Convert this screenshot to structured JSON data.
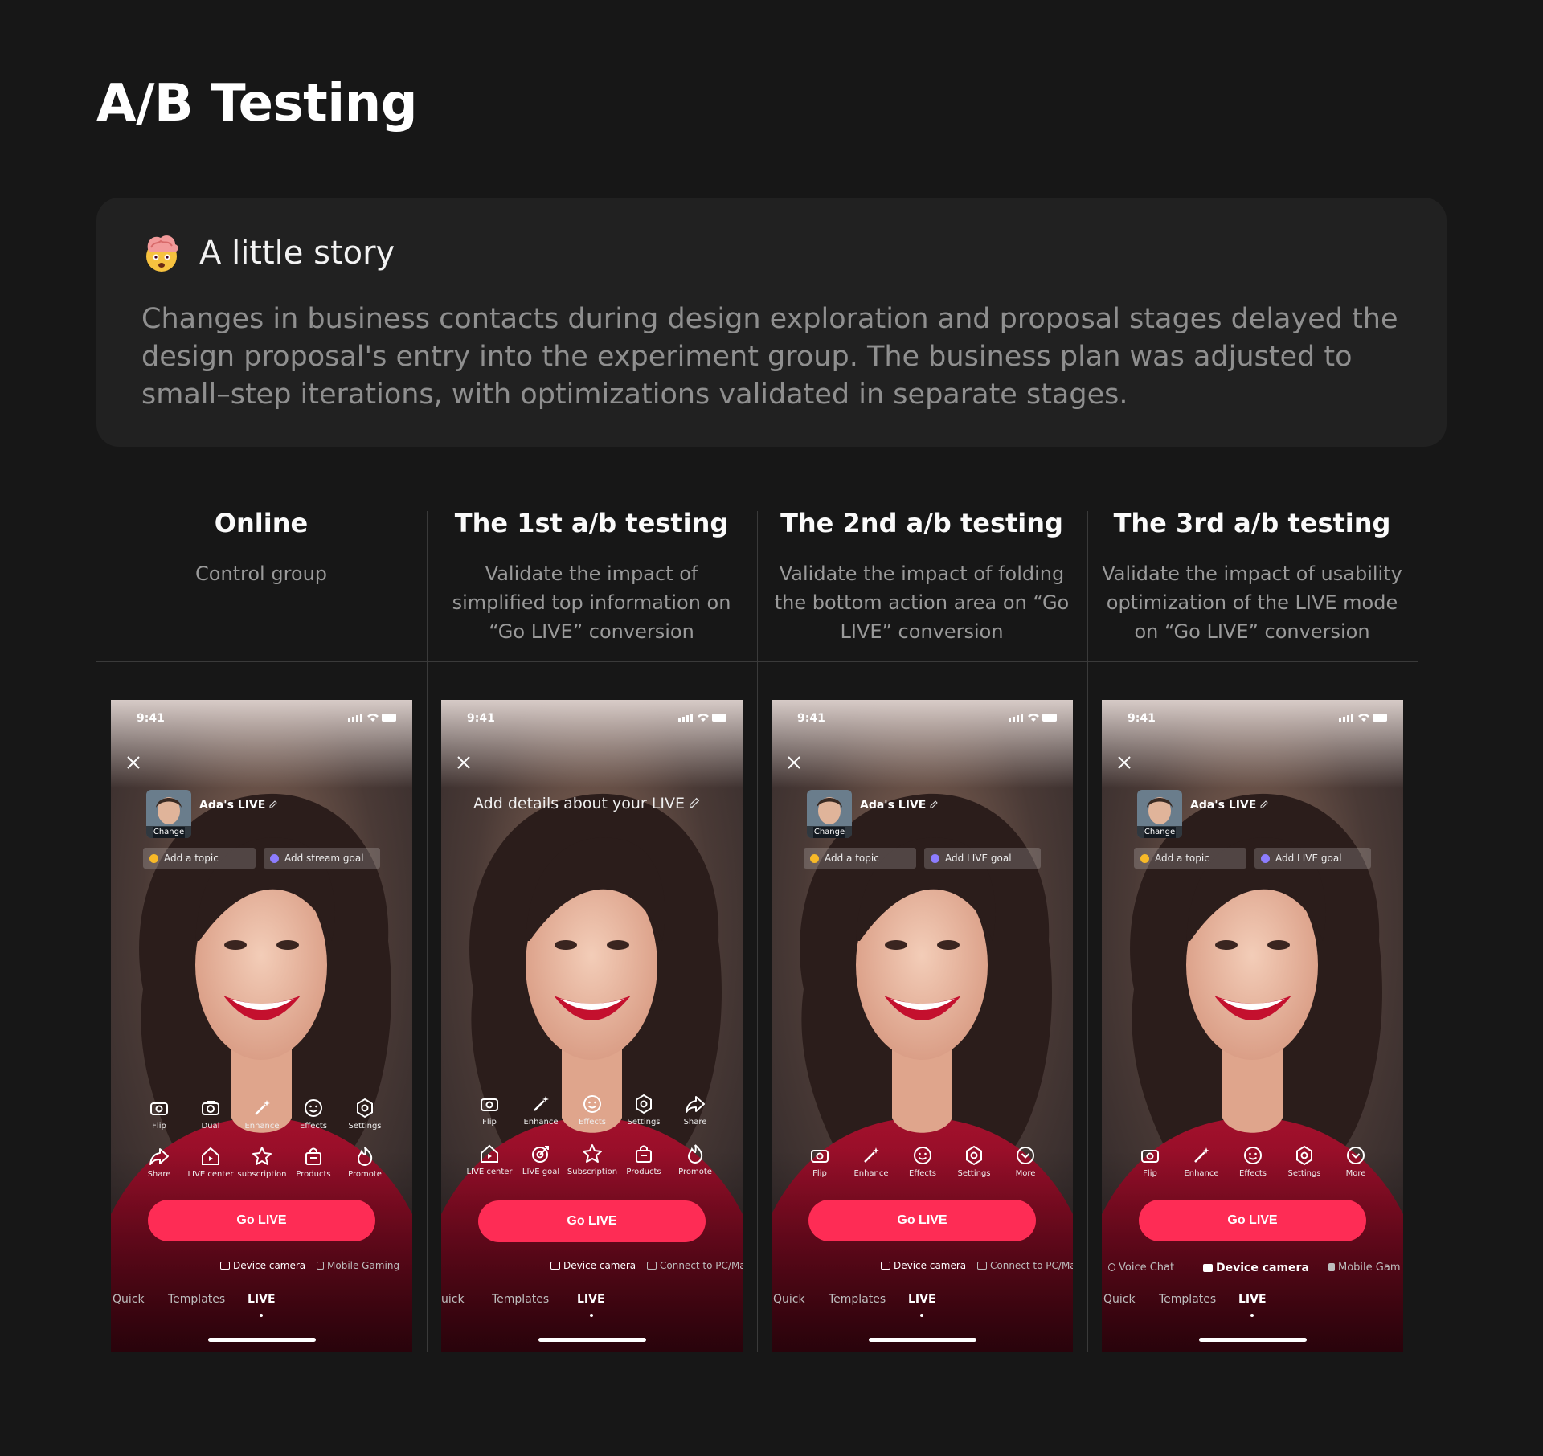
{
  "page": {
    "title": "A/B Testing"
  },
  "story": {
    "heading": "A little story",
    "body": "Changes in business contacts during design exploration and proposal stages delayed the design proposal's entry into the experiment group. The business plan was adjusted to small–step iterations, with optimizations validated in separate stages."
  },
  "columns": [
    {
      "title": "Online",
      "desc": "Control group"
    },
    {
      "title": "The 1st a/b testing",
      "desc": "Validate the impact of simplified top information on “Go LIVE” conversion"
    },
    {
      "title": "The 2nd a/b testing",
      "desc": "Validate the impact of folding the bottom action area on “Go LIVE” conversion"
    },
    {
      "title": "The 3rd a/b testing",
      "desc": "Validate the impact of usability optimization of the LIVE mode on “Go LIVE” conversion"
    }
  ],
  "phones": [
    {
      "status_time": "9:41",
      "live_name": "Ada's LIVE",
      "change_label": "Change",
      "topic_label": "Add a topic",
      "goal_label": "Add stream goal",
      "tools_row1": [
        "Flip",
        "Dual",
        "Enhance",
        "Effects",
        "Settings"
      ],
      "tools_row2": [
        "Share",
        "LIVE center",
        "subscription",
        "Products",
        "Promote"
      ],
      "go_live": "Go LIVE",
      "source_a": "Device camera",
      "source_b": "Mobile Gaming",
      "mode_quick": "Quick",
      "mode_templates": "Templates",
      "mode_live": "LIVE"
    },
    {
      "status_time": "9:41",
      "details_label": "Add details about your LIVE",
      "tools_row1": [
        "Flip",
        "Enhance",
        "Effects",
        "Settings",
        "Share"
      ],
      "tools_row2": [
        "LIVE center",
        "LIVE goal",
        "Subscription",
        "Products",
        "Promote"
      ],
      "go_live": "Go LIVE",
      "source_a": "Device camera",
      "source_b": "Connect to PC/Ma",
      "mode_quick": "uick",
      "mode_templates": "Templates",
      "mode_live": "LIVE"
    },
    {
      "status_time": "9:41",
      "live_name": "Ada's LIVE",
      "change_label": "Change",
      "topic_label": "Add a topic",
      "goal_label": "Add LIVE goal",
      "tools_row1": [
        "Flip",
        "Enhance",
        "Effects",
        "Settings",
        "More"
      ],
      "go_live": "Go LIVE",
      "source_a": "Device camera",
      "source_b": "Connect to PC/Ma",
      "mode_quick": "Quick",
      "mode_templates": "Templates",
      "mode_live": "LIVE"
    },
    {
      "status_time": "9:41",
      "live_name": "Ada's LIVE",
      "change_label": "Change",
      "topic_label": "Add a topic",
      "goal_label": "Add LIVE goal",
      "tools_row1": [
        "Flip",
        "Enhance",
        "Effects",
        "Settings",
        "More"
      ],
      "go_live": "Go LIVE",
      "source_voice": "Voice Chat",
      "source_a": "Device camera",
      "source_b": "Mobile Gam",
      "mode_quick": "Quick",
      "mode_templates": "Templates",
      "mode_live": "LIVE"
    }
  ],
  "colors": {
    "accent": "#fe2c55",
    "background": "#171717",
    "card": "#212121"
  }
}
